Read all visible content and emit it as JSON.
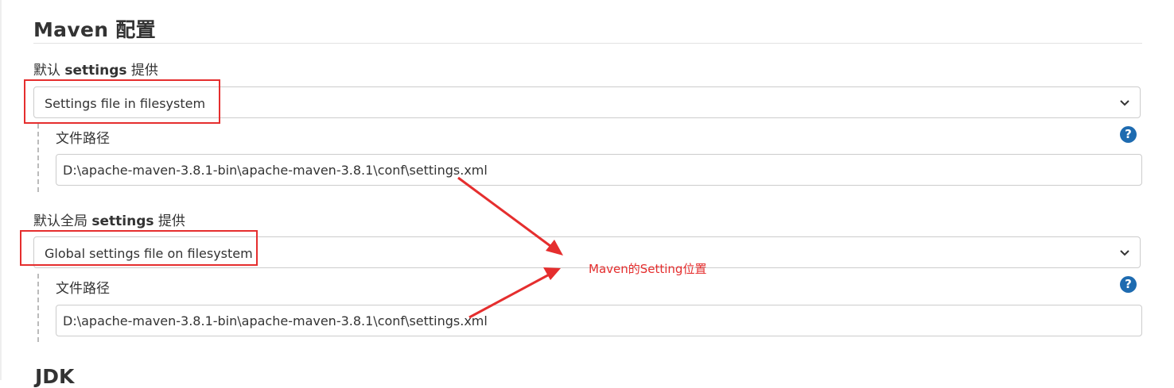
{
  "section": {
    "title": "Maven 配置"
  },
  "default_settings": {
    "label_prefix": "默认 ",
    "label_bold": "settings",
    "label_suffix": " 提供",
    "selected": "Settings file in filesystem",
    "path_label": "文件路径",
    "path_value": "D:\\apache-maven-3.8.1-bin\\apache-maven-3.8.1\\conf\\settings.xml"
  },
  "global_settings": {
    "label_prefix": "默认全局 ",
    "label_bold": "settings",
    "label_suffix": " 提供",
    "selected": "Global settings file on filesystem",
    "path_label": "文件路径",
    "path_value": "D:\\apache-maven-3.8.1-bin\\apache-maven-3.8.1\\conf\\settings.xml"
  },
  "help": {
    "glyph": "?"
  },
  "annotation": {
    "text": "Maven的Setting位置",
    "color": "#e52e2e"
  },
  "next_section": {
    "title": "JDK"
  },
  "colors": {
    "help_icon": "#1e6bb0",
    "annotation_red": "#e52e2e",
    "border": "#cccccc"
  }
}
